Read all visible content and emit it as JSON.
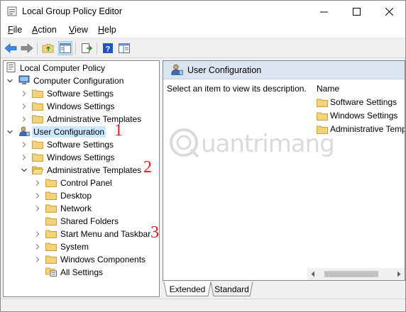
{
  "window": {
    "title": "Local Group Policy Editor"
  },
  "menu": [
    "File",
    "Action",
    "View",
    "Help"
  ],
  "tree": {
    "root": "Local Computer Policy",
    "computer_config": "Computer Configuration",
    "cc_software": "Software Settings",
    "cc_windows": "Windows Settings",
    "cc_admin": "Administrative Templates",
    "user_config": "User Configuration",
    "uc_software": "Software Settings",
    "uc_windows": "Windows Settings",
    "uc_admin": "Administrative Templates",
    "admin_children": [
      "Control Panel",
      "Desktop",
      "Network",
      "Shared Folders",
      "Start Menu and Taskbar",
      "System",
      "Windows Components",
      "All Settings"
    ]
  },
  "annotations": [
    "1",
    "2",
    "3"
  ],
  "right": {
    "header": "User Configuration",
    "description": "Select an item to view its description.",
    "column_name": "Name",
    "items": [
      "Software Settings",
      "Windows Settings",
      "Administrative Templates"
    ]
  },
  "tabs": [
    "Extended",
    "Standard"
  ],
  "watermark": "uantrimang",
  "colors": {
    "selection": "#cce8ff",
    "header_bg": "#dbe5f1",
    "annotation": "#e01b1b",
    "folder": "#f4d27a"
  }
}
